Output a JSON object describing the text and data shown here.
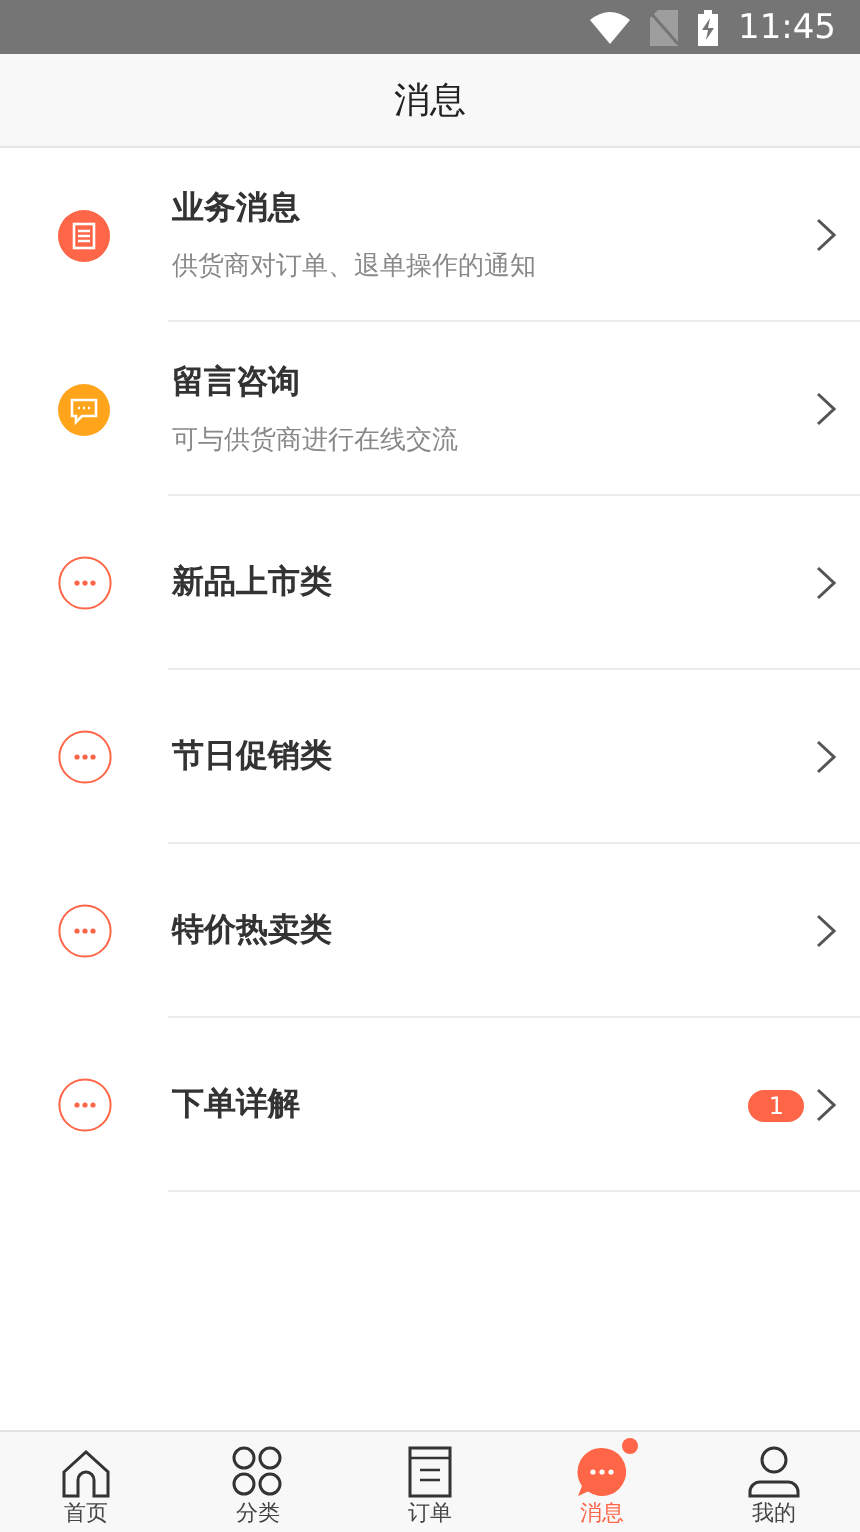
{
  "status_bar": {
    "time": "11:45"
  },
  "header": {
    "title": "消息"
  },
  "messages": [
    {
      "kind": "document",
      "title": "业务消息",
      "subtitle": "供货商对订单、退单操作的通知"
    },
    {
      "kind": "chat",
      "title": "留言咨询",
      "subtitle": "可与供货商进行在线交流"
    },
    {
      "kind": "more",
      "title": "新品上市类"
    },
    {
      "kind": "more",
      "title": "节日促销类"
    },
    {
      "kind": "more",
      "title": "特价热卖类"
    },
    {
      "kind": "more",
      "title": "下单详解",
      "badge": "1"
    }
  ],
  "tab_bar": [
    {
      "kind": "home",
      "label": "首页",
      "selected": false,
      "dot": false
    },
    {
      "kind": "grid",
      "label": "分类",
      "selected": false,
      "dot": false
    },
    {
      "kind": "doc",
      "label": "订单",
      "selected": false,
      "dot": false
    },
    {
      "kind": "chat",
      "label": "消息",
      "selected": true,
      "dot": true
    },
    {
      "kind": "user",
      "label": "我的",
      "selected": false,
      "dot": false
    }
  ]
}
